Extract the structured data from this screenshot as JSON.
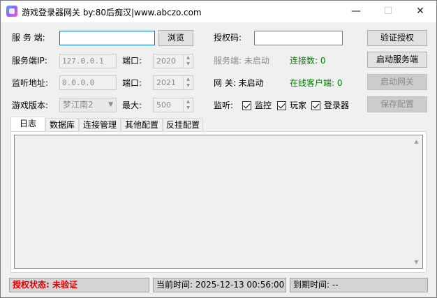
{
  "window": {
    "title": "游戏登录器网关   by:80后痴汉|www.abczo.com",
    "minimize": "—",
    "maximize": "☐",
    "close": "✕"
  },
  "form": {
    "server_label": "服 务 端:",
    "server_value": "",
    "browse_button": "浏览",
    "auth_code_label": "授权码:",
    "auth_code_value": "",
    "verify_button": "验证授权",
    "server_ip_label": "服务端IP:",
    "server_ip_value": "127.0.0.1",
    "port1_label": "端口:",
    "port1_value": "2020",
    "server_status_label": "服务端: 未启动",
    "connections_label": "连接数: 0",
    "start_server_button": "启动服务端",
    "listen_addr_label": "监听地址:",
    "listen_addr_value": "0.0.0.0",
    "port2_label": "端口:",
    "port2_value": "2021",
    "gateway_status_label": "网   关: 未启动",
    "online_clients_label": "在线客户端: 0",
    "start_gateway_button": "启动网关",
    "game_version_label": "游戏版本:",
    "game_version_value": "梦江南2",
    "max_label": "最大:",
    "max_value": "500",
    "listen_label": "监听:",
    "checkbox_monitor": "监控",
    "checkbox_player": "玩家",
    "checkbox_launcher": "登录器",
    "save_config_button": "保存配置"
  },
  "tabs": [
    {
      "label": "日志"
    },
    {
      "label": "数据库"
    },
    {
      "label": "连接管理"
    },
    {
      "label": "其他配置"
    },
    {
      "label": "反挂配置"
    }
  ],
  "status_bar": {
    "auth_status": "授权状态: 未验证",
    "current_time": "当前时间: 2025-12-13 00:56:00",
    "expire_time": "到期时间: --"
  },
  "colors": {
    "status_red": "#e00000",
    "status_green": "#008000"
  }
}
